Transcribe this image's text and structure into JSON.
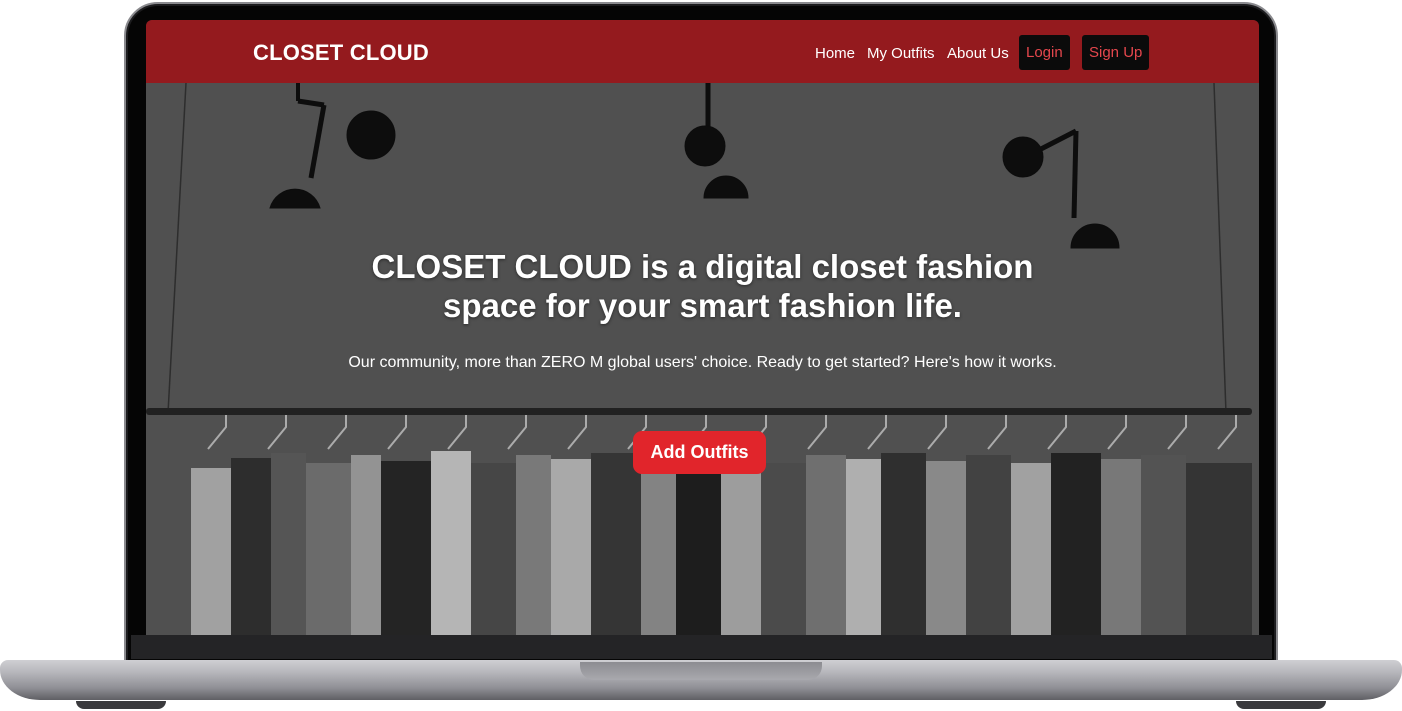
{
  "brand": {
    "name": "CLOSET CLOUD"
  },
  "nav": {
    "links": [
      "Home",
      "My Outfits",
      "About Us"
    ],
    "login_label": "Login",
    "signup_label": "Sign Up"
  },
  "hero": {
    "title": "CLOSET CLOUD is a digital closet fashion space for your smart fashion life.",
    "subtitle": "Our community, more than ZERO M global users' choice. Ready to get started? Here's how it works.",
    "cta_label": "Add Outfits",
    "background_image": "clothing-rack-photo"
  },
  "colors": {
    "nav_bg": "#941a1e",
    "button_bg": "#0b0b0b",
    "button_text": "#e5474d",
    "cta_bg": "#e1252b"
  }
}
